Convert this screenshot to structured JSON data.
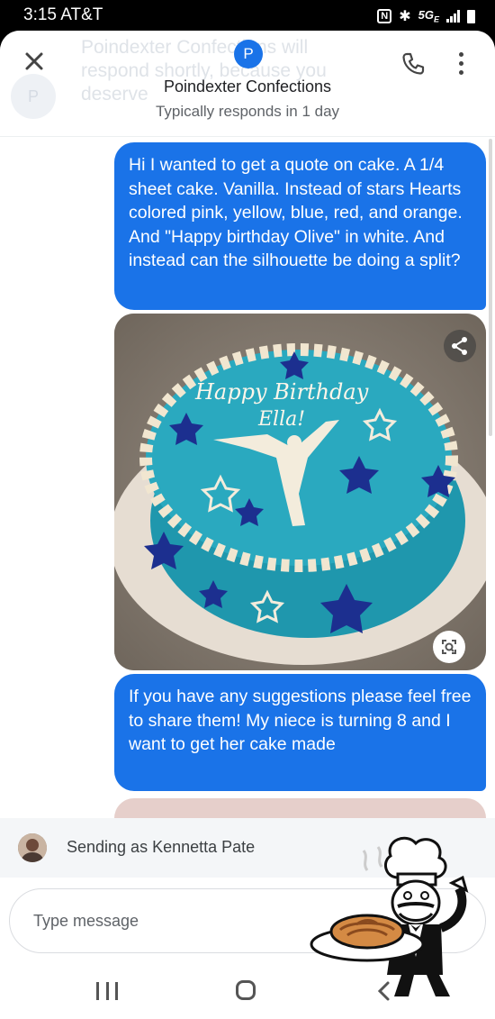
{
  "status_bar": {
    "time_carrier": "3:15 AT&T",
    "nfc_icon": "N",
    "network": "5G",
    "network_sub": "E"
  },
  "header": {
    "ghost_text": "Poindexter Confections will respond shortly, because you deserve",
    "ghost_avatar_letter": "P",
    "avatar_letter": "P",
    "business_name": "Poindexter Confections",
    "response_time": "Typically responds in 1 day"
  },
  "messages": [
    {
      "text": "Hi I wanted to get a quote on cake. A 1/4 sheet cake. Vanilla. Instead of stars Hearts colored pink, yellow, blue, red, and orange. And \"Happy birthday Olive\" in white. And instead can the silhouette be doing a split?"
    },
    {
      "text": "If you have any suggestions please feel free to share them! My niece is turning 8  and I want to get her cake made"
    }
  ],
  "photo": {
    "cake_text_line1": "Happy Birthday",
    "cake_text_line2": "Ella!"
  },
  "sending_as": "Sending as Kennetta Pate",
  "input": {
    "placeholder": "Type message"
  },
  "icons": {
    "close": "close-icon",
    "call": "phone-icon",
    "more": "more-vert-icon",
    "share": "share-icon",
    "lens": "lens-icon",
    "recent": "recent-apps-icon",
    "home": "home-icon",
    "back": "back-icon"
  },
  "colors": {
    "bubble": "#1a73e8",
    "accent": "#1a73e8",
    "cake_top": "#2aa9bf"
  }
}
